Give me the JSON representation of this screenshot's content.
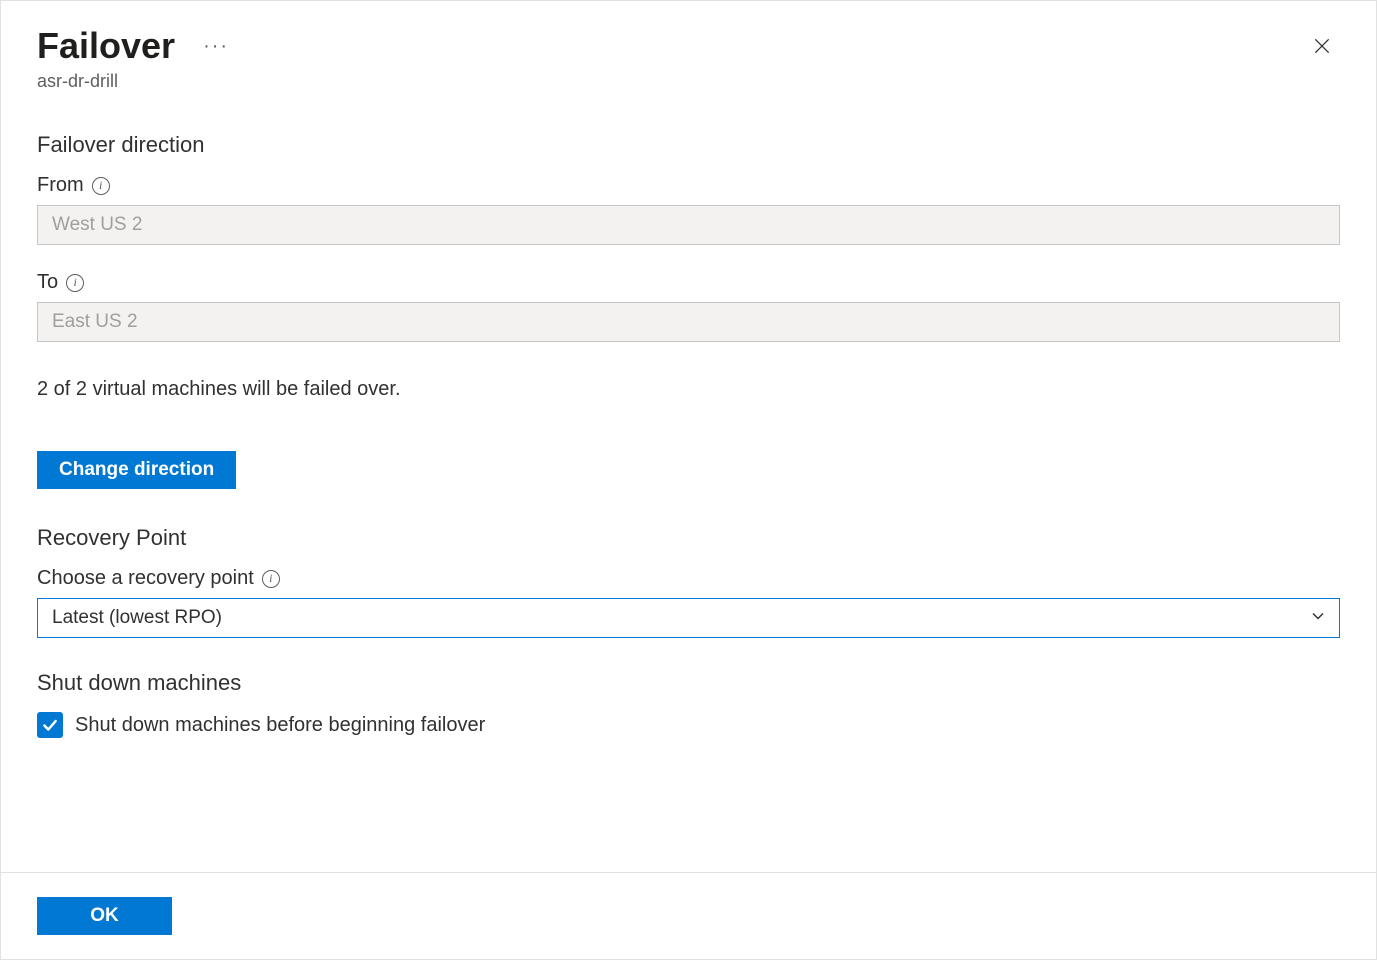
{
  "header": {
    "title": "Failover",
    "subtitle": "asr-dr-drill"
  },
  "direction": {
    "heading": "Failover direction",
    "from_label": "From",
    "from_value": "West US 2",
    "to_label": "To",
    "to_value": "East US 2",
    "status": "2 of 2 virtual machines will be failed over.",
    "change_button": "Change direction"
  },
  "recovery": {
    "heading": "Recovery Point",
    "label": "Choose a recovery point",
    "selected": "Latest (lowest RPO)"
  },
  "shutdown": {
    "heading": "Shut down machines",
    "checkbox_label": "Shut down machines before beginning failover",
    "checked": true
  },
  "footer": {
    "ok_button": "OK"
  }
}
